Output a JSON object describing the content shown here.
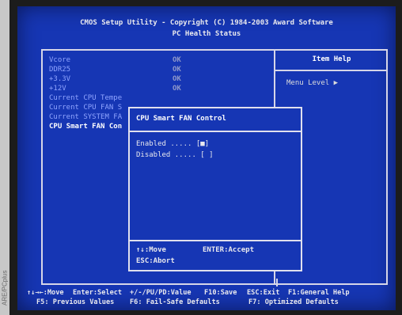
{
  "credit": "ARE/PCplus",
  "header": {
    "line1": "CMOS Setup Utility - Copyright (C) 1984-2003 Award Software",
    "line2": "PC Health Status"
  },
  "rows": [
    {
      "label": "Vcore",
      "value": "OK"
    },
    {
      "label": "DDR25",
      "value": "OK"
    },
    {
      "label": "+3.3V",
      "value": "OK"
    },
    {
      "label": "+12V",
      "value": "OK"
    },
    {
      "label": "Current CPU Tempe",
      "value": ""
    },
    {
      "label": "Current CPU FAN S",
      "value": ""
    },
    {
      "label": "Current SYSTEM FA",
      "value": ""
    },
    {
      "label": "CPU Smart FAN Con",
      "value": ""
    }
  ],
  "help": {
    "title": "Item Help",
    "menu_level": "Menu Level  ▶"
  },
  "popup": {
    "title": "CPU Smart FAN Control",
    "options": [
      "Enabled  ..... [■]",
      "Disabled ..... [ ]"
    ],
    "move_keys": "↑↓:Move",
    "enter_key": "ENTER:Accept",
    "esc_key": "ESC:Abort"
  },
  "footer": {
    "row1": [
      "↑↓→←:Move",
      "Enter:Select",
      "+/-/PU/PD:Value",
      "F10:Save",
      "ESC:Exit",
      "F1:General Help"
    ],
    "row2": [
      "F5: Previous Values",
      "F6: Fail-Safe Defaults",
      "F7: Optimized Defaults"
    ]
  }
}
